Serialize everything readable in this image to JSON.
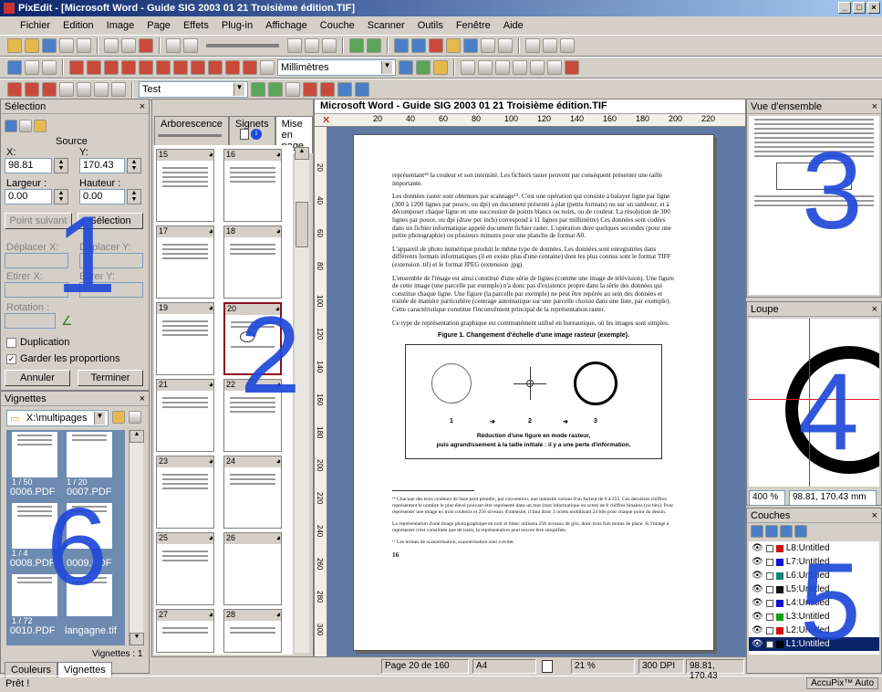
{
  "window": {
    "title": "PixEdit - [Microsoft Word - Guide SIG 2003 01 21 Troisième édition.TIF]",
    "buttons": [
      "_",
      "□",
      "×"
    ]
  },
  "menu": [
    "Fichier",
    "Edition",
    "Image",
    "Page",
    "Effets",
    "Plug-in",
    "Affichage",
    "Couche",
    "Scanner",
    "Outils",
    "Fenêtre",
    "Aide"
  ],
  "toolbar": {
    "units": "Millimètres",
    "script_name": "Test"
  },
  "selection_panel": {
    "title": "Sélection",
    "source_label": "Source",
    "x_label": "X:",
    "y_label": "Y:",
    "x_value": "98.81",
    "y_value": "170.43",
    "width_label": "Largeur :",
    "height_label": "Hauteur :",
    "width_value": "0.00",
    "height_value": "0.00",
    "next_point": "Point suivant",
    "selection_button": "Sélection",
    "move_x": "Déplacer X:",
    "move_y": "Déplacer Y:",
    "stretch_x": "Etirer X:",
    "stretch_y": "Etirer Y:",
    "rotation": "Rotation :",
    "duplication": "Duplication",
    "keep_proportions": "Garder les proportions",
    "cancel": "Annuler",
    "finish": "Terminer",
    "area_number": "1"
  },
  "vignettes_panel": {
    "title": "Vignettes",
    "folder": "X:\\multipages",
    "files": [
      {
        "pages": "1 / 50",
        "name": "0006.PDF"
      },
      {
        "pages": "1 / 20",
        "name": "0007.PDF"
      },
      {
        "pages": "1 / 4",
        "name": "0008.PDF"
      },
      {
        "pages": "",
        "name": "0009.PDF"
      },
      {
        "pages": "1 / 72",
        "name": "0010.PDF"
      },
      {
        "pages": "",
        "name": "langagne.tif"
      }
    ],
    "count": "Vignettes : 1",
    "tab_layers": "Couleurs",
    "tab_vignettes": "Vignettes",
    "area_number": "6"
  },
  "pages_panel": {
    "tabs": [
      "Arborescence",
      "Signets",
      "Mise en page"
    ],
    "pages": [
      "15",
      "16",
      "17",
      "18",
      "19",
      "20",
      "21",
      "22",
      "23",
      "24",
      "25",
      "26",
      "27",
      "28"
    ],
    "selected_page": "20",
    "area_number": "2"
  },
  "document": {
    "title": "Microsoft Word - Guide SIG 2003 01 21 Troisième édition.TIF",
    "ruler_top": [
      "20",
      "40",
      "60",
      "80",
      "100",
      "120",
      "140",
      "160",
      "180",
      "200",
      "220"
    ],
    "ruler_left": [
      "20",
      "40",
      "60",
      "80",
      "100",
      "120",
      "140",
      "160",
      "180",
      "200",
      "220",
      "240",
      "260",
      "280",
      "300"
    ],
    "paragraphs": [
      "représentant¹⁴ la couleur et son intensité. Les fichiers raster peuvent par conséquent présenter une taille importante.",
      "Les données raster sont obtenues par scannage¹⁵. C'est une opération qui consiste à balayer ligne par ligne (300 à 1200 lignes par pouce, ou dpi) un document présenté à plat (petits formats) ou sur un tambour, et à décomposer chaque ligne en une succession de points blancs ou noirs, ou de couleur. La résolution de 300 lignes par pouce, ou dpi (draw per inch) correspond à 11 lignes par millimètre) Ces données sont codées dans un fichier informatique appelé document fichier raster. L'opération dure quelques secondes (pour une petite photographie) ou plusieurs minutes pour une planche de format A0.",
      "L'appareil de photo numérique produit le même type de données. Les données sont enregistrées dans différents formats informatiques (il en existe plus d'une centaine) dont les plus connus sont le format TIFF (extension .tif) et le format JPEG (extension .jpg).",
      "L'ensemble de l'image est ainsi constitué d'une série de lignes (comme une image de télévision). Une figure de cette image (une parcelle par exemple) n'a donc pas d'existence propre dans la série des données qui constitue chaque ligne. Une figure (la parcelle par exemple) ne peut être repérée au sein des données et traitée de manière particulière (centrage automatique sur une parcelle choisie dans une liste, par exemple). Cette caractéristique constitue l'inconvénient principal de la représentation raster.",
      "Ce type de représentation graphique est communément utilisé en bureautique, où les images sont simples."
    ],
    "figure_title": "Figure 1. Changement d'échelle d'une image rasteur (exemple).",
    "figure_steps": [
      "1",
      "2",
      "3"
    ],
    "figure_caption_1": "Réduction d'une figure en mode rasteur,",
    "figure_caption_2": "puis agrandissement à la taille initiale : il y a une perte d'information.",
    "footnote_1": "¹⁴ Chacune des trois couleurs de base peut prendre, par convention, une intensité variant d'un facteur de 0 à 255. Ces dernières chiffres représentent le nombre le plus élevé pouvant être représenté dans un mot (mot informatique ou octet) de 8 chiffres binaires (ou bits). Pour représenter une image en trois couleurs et 256 niveaux d'intensité, il faut donc 3 octets mobilisant 24 bits pour chaque point du dessin.",
    "footnote_2": "La représentation d'une image photographique en noir et blanc utilisera 256 niveaux de gris, donc trois fois moins de place. Si l'image à représenter n'est constituée que de traits, la représentation peut encore être simplifiée.",
    "footnote_3": "¹⁵ Les termes de scannérisation, scannérisation sont à éviter.",
    "page_number": "16"
  },
  "overview_panel": {
    "title": "Vue d'ensemble",
    "area_number": "3"
  },
  "loupe_panel": {
    "title": "Loupe",
    "zoom": "400 %",
    "coords": "98.81, 170.43 mm",
    "area_number": "4"
  },
  "layers_panel": {
    "title": "Couches",
    "layers": [
      {
        "name": "L8:Untitled",
        "color": "#d01010"
      },
      {
        "name": "L7:Untitled",
        "color": "#1010d0"
      },
      {
        "name": "L6:Untitled",
        "color": "#108080"
      },
      {
        "name": "L5:Untitled",
        "color": "#101010"
      },
      {
        "name": "L4:Untitled",
        "color": "#1010d0"
      },
      {
        "name": "L3:Untitled",
        "color": "#10a010"
      },
      {
        "name": "L2:Untitled",
        "color": "#d01010"
      },
      {
        "name": "L1:Untitled",
        "color": "#000000"
      }
    ],
    "selected_layer": "L1:Untitled",
    "area_number": "5"
  },
  "status": {
    "left": "Prêt !",
    "page": "Page 20 de 160",
    "paper": "A4",
    "zoom": "21 %",
    "dpi": "300 DPI",
    "coords": "98.81, 170.43",
    "brand": "AccuPix™ Auto"
  }
}
